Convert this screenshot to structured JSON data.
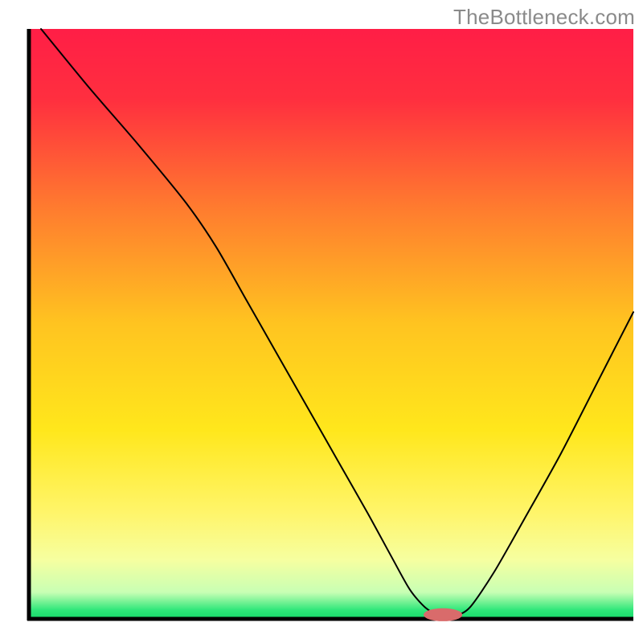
{
  "watermark": "TheBottleneck.com",
  "chart_data": {
    "type": "line",
    "title": "",
    "xlabel": "",
    "ylabel": "",
    "xlim": [
      0,
      100
    ],
    "ylim": [
      0,
      100
    ],
    "axes": {
      "left": true,
      "bottom": true,
      "right": false,
      "top": false,
      "ticks": false,
      "grid": false
    },
    "background_gradient": {
      "stops": [
        {
          "offset": 0.0,
          "color": "#ff1e46"
        },
        {
          "offset": 0.12,
          "color": "#ff2f3f"
        },
        {
          "offset": 0.3,
          "color": "#ff7a2f"
        },
        {
          "offset": 0.5,
          "color": "#ffc420"
        },
        {
          "offset": 0.68,
          "color": "#ffe71c"
        },
        {
          "offset": 0.82,
          "color": "#fff56a"
        },
        {
          "offset": 0.9,
          "color": "#f6ffa0"
        },
        {
          "offset": 0.955,
          "color": "#c8ffb4"
        },
        {
          "offset": 0.985,
          "color": "#2fe77a"
        },
        {
          "offset": 1.0,
          "color": "#16d96a"
        }
      ]
    },
    "series": [
      {
        "name": "bottleneck-curve",
        "color": "#000000",
        "width": 2,
        "x": [
          2,
          10,
          18,
          26,
          31,
          36,
          41,
          46,
          51,
          56,
          60,
          63,
          65.5,
          68,
          70.5,
          73,
          77,
          82,
          88,
          94,
          100
        ],
        "y": [
          100,
          90,
          80.5,
          70.5,
          63,
          54,
          45,
          36,
          27,
          18,
          10.5,
          5,
          2,
          0.5,
          0.5,
          2,
          8,
          17,
          28,
          40,
          52
        ]
      }
    ],
    "marker": {
      "name": "optimal-pill",
      "color": "#d96b6b",
      "cx": 68.5,
      "cy": 0.7,
      "rx": 3.2,
      "ry": 1.1
    }
  }
}
